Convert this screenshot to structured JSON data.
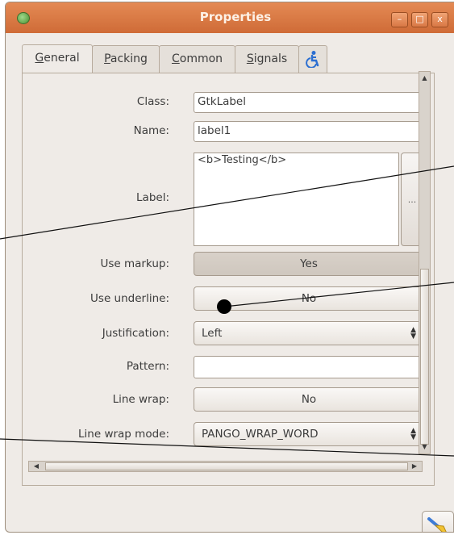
{
  "window": {
    "title": "Properties",
    "buttons": {
      "minimize": "–",
      "maximize": "□",
      "close": "x"
    }
  },
  "tabs": [
    {
      "mnemonic": "G",
      "rest": "eneral"
    },
    {
      "mnemonic": "P",
      "rest": "acking"
    },
    {
      "mnemonic": "C",
      "rest": "ommon"
    },
    {
      "mnemonic": "S",
      "rest": "ignals"
    }
  ],
  "accessibility_tab_icon": "accessibility-icon",
  "properties": {
    "class": {
      "label": "Class:",
      "value": "GtkLabel"
    },
    "name": {
      "label": "Name:",
      "value": "label1"
    },
    "label": {
      "label": "Label:",
      "value": "<b>Testing</b>",
      "edit_button": "..."
    },
    "use_markup": {
      "label": "Use markup:",
      "value": "Yes"
    },
    "use_underline": {
      "label": "Use underline:",
      "value": "No"
    },
    "justification": {
      "label": "Justification:",
      "value": "Left"
    },
    "pattern": {
      "label": "Pattern:",
      "value": ""
    },
    "line_wrap": {
      "label": "Line wrap:",
      "value": "No"
    },
    "line_wrap_mode": {
      "label": "Line wrap mode:",
      "value": "PANGO_WRAP_WORD"
    }
  },
  "colors": {
    "titlebar": "#d8753f",
    "window_bg": "#efebe7",
    "accent_blue": "#2c6fd1"
  }
}
